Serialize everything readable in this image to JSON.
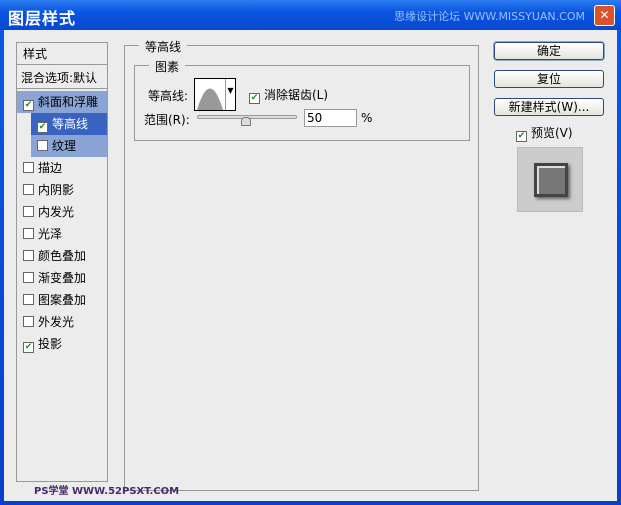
{
  "window": {
    "title": "图层样式",
    "watermark": "思缘设计论坛 WWW.MISSYUAN.COM",
    "close": "✕"
  },
  "styles": {
    "header": "样式",
    "blend": "混合选项:默认",
    "items": [
      {
        "label": "斜面和浮雕",
        "checked": true
      },
      {
        "label": "等高线",
        "checked": true
      },
      {
        "label": "纹理",
        "checked": false
      },
      {
        "label": "描边",
        "checked": false
      },
      {
        "label": "内阴影",
        "checked": false
      },
      {
        "label": "内发光",
        "checked": false
      },
      {
        "label": "光泽",
        "checked": false
      },
      {
        "label": "颜色叠加",
        "checked": false
      },
      {
        "label": "渐变叠加",
        "checked": false
      },
      {
        "label": "图案叠加",
        "checked": false
      },
      {
        "label": "外发光",
        "checked": false
      },
      {
        "label": "投影",
        "checked": true
      }
    ]
  },
  "panel": {
    "title": "等高线",
    "group": "图素",
    "contour_label": "等高线:",
    "antialias": "消除锯齿(L)",
    "antialias_checked": true,
    "range_label": "范围(R):",
    "range_value": "50",
    "range_unit": "%",
    "range_percent": 50
  },
  "buttons": {
    "ok": "确定",
    "reset": "复位",
    "new_style": "新建样式(W)...",
    "preview": "预览(V)",
    "preview_checked": true
  },
  "footer_watermark": "PS学堂 WWW.52PSXT.COM"
}
